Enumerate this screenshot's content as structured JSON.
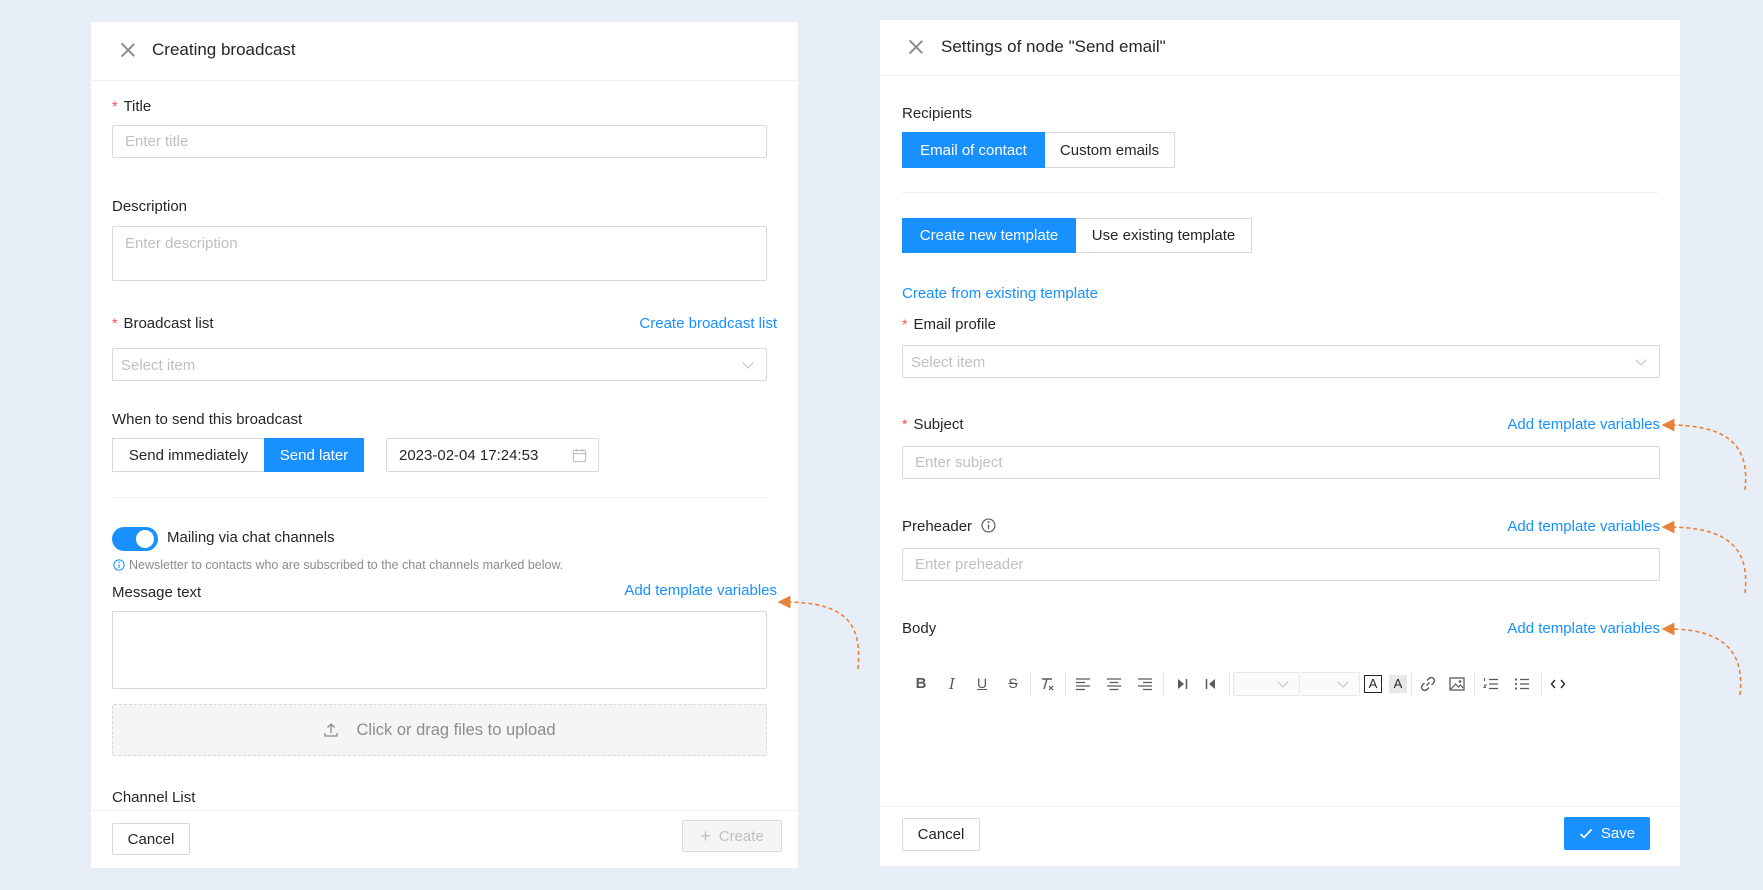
{
  "left": {
    "title": "Creating broadcast",
    "title_field": {
      "label": "Title",
      "placeholder": "Enter title"
    },
    "description": {
      "label": "Description",
      "placeholder": "Enter description"
    },
    "broadcast_list": {
      "label": "Broadcast list",
      "link": "Create broadcast list",
      "placeholder": "Select item"
    },
    "when": {
      "label": "When to send this broadcast",
      "options": [
        "Send immediately",
        "Send later"
      ],
      "active": "Send later",
      "datetime": "2023-02-04 17:24:53"
    },
    "mailing": {
      "label": "Mailing via chat channels",
      "enabled": true,
      "hint": "Newsletter to contacts who are subscribed to the chat channels marked below."
    },
    "message": {
      "label": "Message text",
      "link": "Add template variables"
    },
    "upload": {
      "text": "Click or drag files to upload"
    },
    "channel_list": {
      "label": "Channel List"
    },
    "footer": {
      "cancel": "Cancel",
      "create": "Create"
    }
  },
  "right": {
    "title": "Settings of node \"Send email\"",
    "recipients": {
      "label": "Recipients",
      "options": [
        "Email of contact",
        "Custom emails"
      ],
      "active": "Email of contact"
    },
    "template_mode": {
      "options": [
        "Create new template",
        "Use existing template"
      ],
      "active": "Create new template"
    },
    "create_from_link": "Create from existing template",
    "email_profile": {
      "label": "Email profile",
      "placeholder": "Select item"
    },
    "subject": {
      "label": "Subject",
      "link": "Add template variables",
      "placeholder": "Enter subject"
    },
    "preheader": {
      "label": "Preheader",
      "link": "Add template variables",
      "placeholder": "Enter preheader"
    },
    "body": {
      "label": "Body",
      "link": "Add template variables"
    },
    "footer": {
      "cancel": "Cancel",
      "save": "Save"
    }
  },
  "colors": {
    "primary": "#1890ff",
    "required": "#ff4d4f",
    "annotation_arrow": "#e8823a",
    "background": "#e8eef7"
  }
}
